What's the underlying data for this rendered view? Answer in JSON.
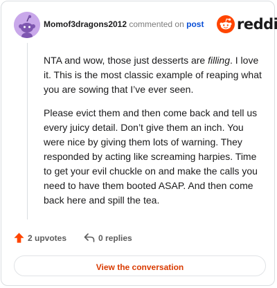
{
  "comment": {
    "author": "Momof3dragons2012",
    "action_text": "commented on",
    "post_link_label": "post",
    "paragraphs": [
      {
        "before": "NTA and wow, those just desserts are ",
        "emphasis": "filling",
        "after": ". I love it. This is the most classic example of reaping what you are sowing that I’ve ever seen."
      },
      {
        "text": "Please evict them and then come back and tell us every juicy detail. Don’t give them an inch. You were nice by giving them lots of warning. They responded by acting like screaming harpies. Time to get your evil chuckle on and make the calls you need to have them booted ASAP. And then come back here and spill the tea."
      }
    ],
    "upvotes_label": "2 upvotes",
    "replies_label": "0 replies"
  },
  "brand": {
    "name": "reddit",
    "icon": "reddit-snoo-icon"
  },
  "cta": {
    "label": "View the conversation"
  },
  "icons": {
    "avatar": "snoo-avatar",
    "upvote": "upvote-arrow-icon",
    "reply": "reply-arrow-icon"
  },
  "colors": {
    "accent": "#ff4500",
    "link": "#0a4fd6",
    "button_text": "#d93a00",
    "avatar_bg": "#c9a8ea"
  }
}
